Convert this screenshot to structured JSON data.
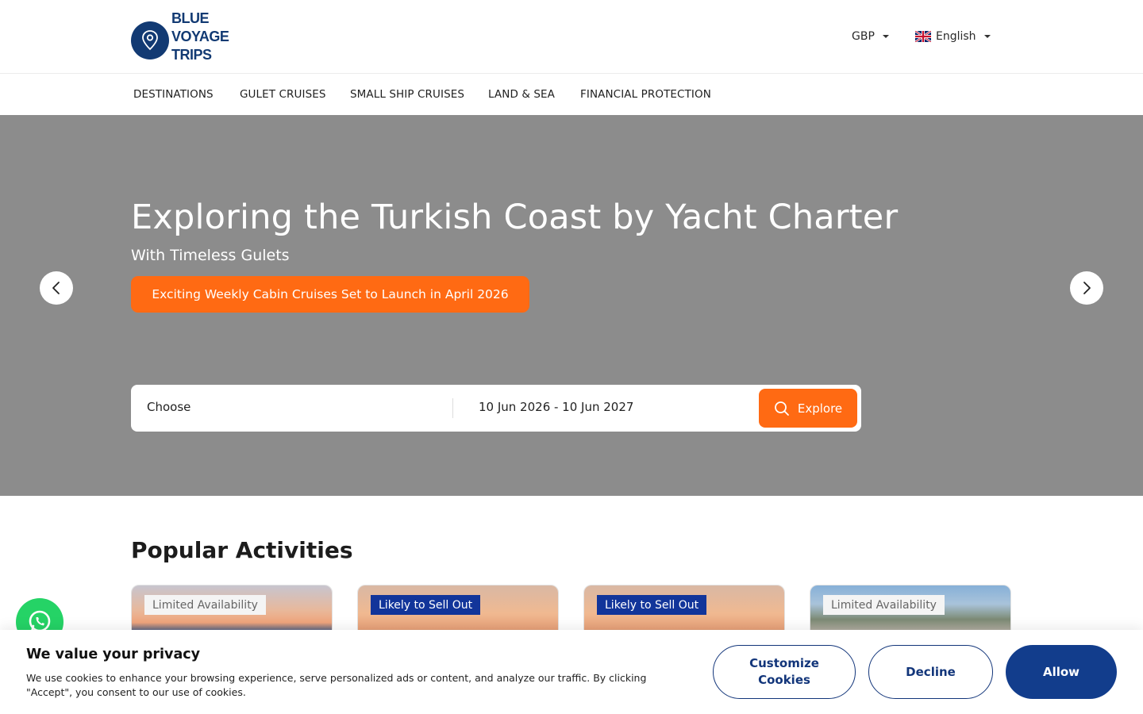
{
  "header": {
    "logo_lines": [
      "BLUE",
      "VOYAGE",
      "TRIPS"
    ],
    "currency": "GBP",
    "language": "English",
    "logo_icon": "map-pin-icon",
    "flag_icon": "uk-flag-icon",
    "brand_color": "#123a73"
  },
  "nav": {
    "items": [
      "DESTINATIONS",
      "GULET CRUISES",
      "SMALL SHIP CRUISES",
      "LAND & SEA",
      "FINANCIAL PROTECTION"
    ]
  },
  "hero": {
    "title": "Exploring the Turkish Coast by Yacht Charter",
    "subtitle": "With Timeless Gulets",
    "promo": "Exciting Weekly Cabin Cruises Set to Launch in April 2026",
    "prev_icon": "chevron-left-icon",
    "next_icon": "chevron-right-icon",
    "accent_color": "#ff6a13"
  },
  "search": {
    "destination_placeholder": "Choose",
    "dates": "10 Jun 2026 - 10 Jun 2027",
    "button_label": "Explore",
    "button_icon": "search-icon"
  },
  "popular": {
    "title": "Popular Activities",
    "cards": [
      {
        "badge": "Limited Availability",
        "badge_type": "limited"
      },
      {
        "badge": "Likely to Sell Out",
        "badge_type": "sell"
      },
      {
        "badge": "Likely to Sell Out",
        "badge_type": "sell"
      },
      {
        "badge": "Limited Availability",
        "badge_type": "limited"
      }
    ]
  },
  "whatsapp": {
    "icon": "whatsapp-icon"
  },
  "cookie": {
    "title": "We value your privacy",
    "text": "We use cookies to enhance your browsing experience, serve personalized ads or content, and analyze our traffic. By clicking \"Accept\", you consent to our use of cookies.",
    "customize_label": "Customize Cookies",
    "decline_label": "Decline",
    "allow_label": "Allow"
  }
}
